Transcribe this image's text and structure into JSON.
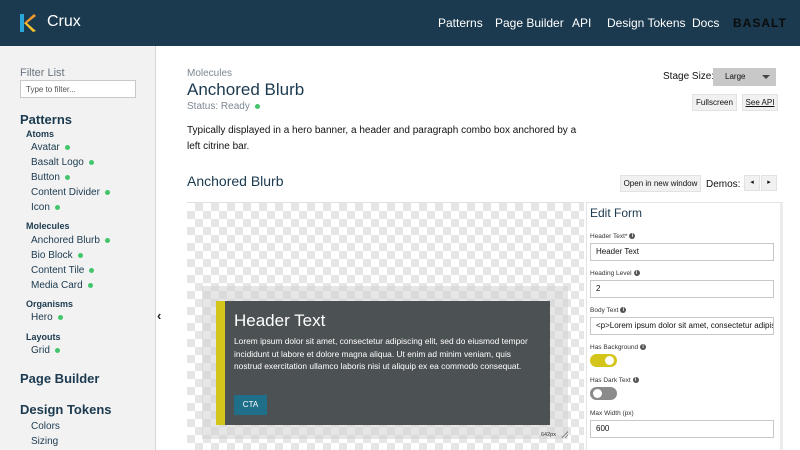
{
  "header": {
    "brand": "Crux",
    "nav": [
      "Patterns",
      "Page Builder",
      "API",
      "Design Tokens",
      "Docs"
    ],
    "partner_logo": "BASALT",
    "colors": {
      "bar": "#1b3a4f",
      "logo_orange": "#f49a2c",
      "logo_blue": "#2aa6d8"
    }
  },
  "sidebar": {
    "filter_label": "Filter List",
    "filter_placeholder": "Type to filter...",
    "sections": {
      "patterns": "Patterns",
      "page_builder": "Page Builder",
      "design_tokens": "Design Tokens"
    },
    "groups": {
      "atoms": "Atoms",
      "molecules": "Molecules",
      "organisms": "Organisms",
      "layouts": "Layouts"
    },
    "atoms": [
      "Avatar",
      "Basalt Logo",
      "Button",
      "Content Divider",
      "Icon"
    ],
    "molecules": [
      "Anchored Blurb",
      "Bio Block",
      "Content Tile",
      "Media Card"
    ],
    "organisms": [
      "Hero"
    ],
    "layouts": [
      "Grid"
    ],
    "design_tokens": [
      "Colors",
      "Sizing"
    ],
    "status_color": "#43c66b"
  },
  "main": {
    "eyebrow": "Molecules",
    "title": "Anchored Blurb",
    "status": "Status: Ready",
    "description": "Typically displayed in a hero banner, a header and paragraph combo box anchored by a left citrine bar.",
    "stage_size_label": "Stage Size:",
    "stage_size_value": "Large",
    "fullscreen": "Fullscreen",
    "see_api": "See API",
    "demo_title": "Anchored Blurb",
    "open_new_window": "Open in new window",
    "demos_label": "Demos:",
    "prev": "◂",
    "next": "▸"
  },
  "preview": {
    "header_text": "Header Text",
    "body": "Lorem ipsum dolor sit amet, consectetur adipiscing elit, sed do eiusmod tempor incididunt ut labore et dolore magna aliqua. Ut enim ad minim veniam, quis nostrud exercitation ullamco laboris nisi ut aliquip ex ea commodo consequat.",
    "cta": "CTA",
    "width_label": "642px",
    "colors": {
      "bar": "#d4c51a",
      "box": "#4c5154",
      "cta": "#1f6f8b"
    }
  },
  "form": {
    "title": "Edit Form",
    "header_text_label": "Header Text*",
    "header_text_value": "Header Text",
    "heading_level_label": "Heading Level",
    "heading_level_value": "2",
    "body_text_label": "Body Text",
    "body_text_value": "<p>Lorem ipsum dolor sit amet, consectetur adipiscing",
    "has_background_label": "Has Background",
    "has_background": true,
    "has_dark_text_label": "Has Dark Text",
    "has_dark_text": false,
    "max_width_label": "Max Width (px)",
    "max_width_value": "600"
  }
}
